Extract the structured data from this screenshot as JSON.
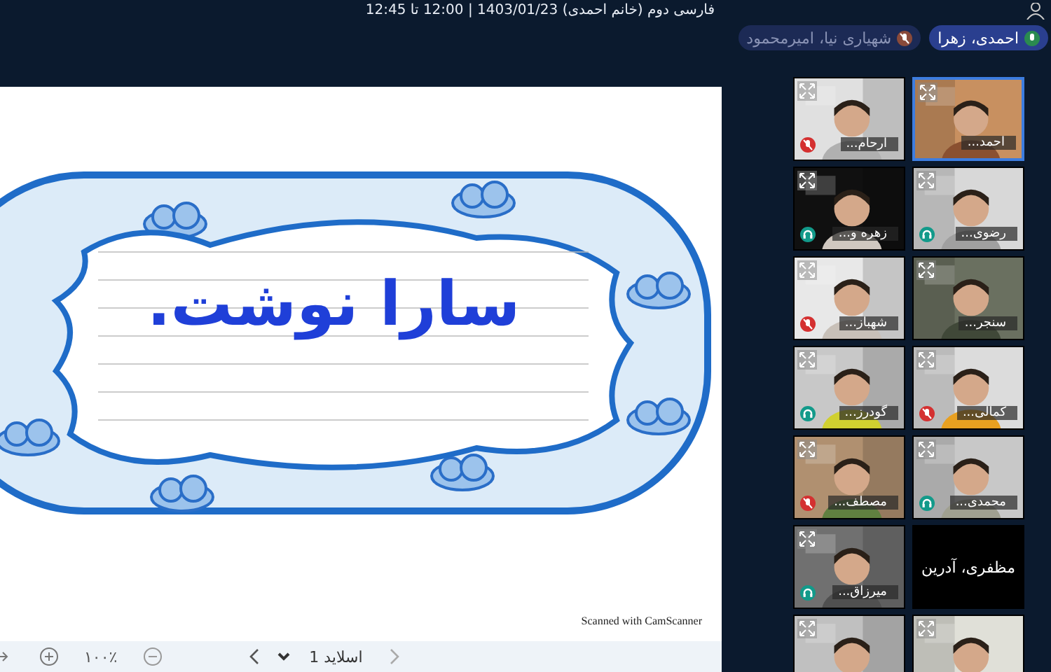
{
  "header": {
    "title": "فارسی دوم (خانم احمدی) 1403/01/23 | 12:00 تا 12:45"
  },
  "speakers": [
    {
      "name": "احمدی، زهرا",
      "talking": true
    },
    {
      "name": "شهیاری نیا، امیرمحمود",
      "talking": false
    }
  ],
  "slide": {
    "text": "سارا نوشت.",
    "footer": "Scanned with CamScanner"
  },
  "toolbar": {
    "zoom": "۱۰۰٪",
    "slide_label": "اسلاید 1"
  },
  "participants": [
    {
      "kind": "video",
      "name": "احمد...",
      "muted": false,
      "headset": false,
      "selected": true
    },
    {
      "kind": "video",
      "name": "ارحام...",
      "muted": true,
      "headset": false,
      "selected": false
    },
    {
      "kind": "video",
      "name": "رضوی...",
      "muted": false,
      "headset": true,
      "selected": false
    },
    {
      "kind": "video",
      "name": "زهره و...",
      "muted": false,
      "headset": true,
      "selected": false
    },
    {
      "kind": "video",
      "name": "سنجر...",
      "muted": false,
      "headset": false,
      "selected": false
    },
    {
      "kind": "video",
      "name": "شهباز...",
      "muted": true,
      "headset": false,
      "selected": false
    },
    {
      "kind": "video",
      "name": "کمالی...",
      "muted": true,
      "headset": false,
      "selected": false
    },
    {
      "kind": "video",
      "name": "گودرز...",
      "muted": false,
      "headset": true,
      "selected": false
    },
    {
      "kind": "video",
      "name": "محمدی...",
      "muted": false,
      "headset": true,
      "selected": false
    },
    {
      "kind": "video",
      "name": "مصطف...",
      "muted": true,
      "headset": false,
      "selected": false
    },
    {
      "kind": "off",
      "name": "مظفری، آدرین",
      "muted": false,
      "headset": false,
      "selected": false
    },
    {
      "kind": "video",
      "name": "میرزاق...",
      "muted": false,
      "headset": true,
      "selected": false
    },
    {
      "kind": "video",
      "selected": false
    },
    {
      "kind": "video",
      "selected": false
    }
  ]
}
